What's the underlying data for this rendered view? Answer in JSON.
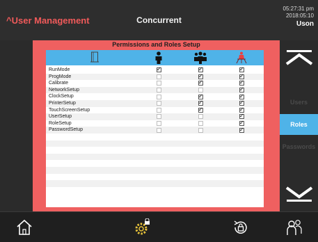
{
  "header": {
    "app_title": "^User Management",
    "mode": "Concurrent",
    "time": "05:27:31 pm",
    "date": "2018:05:10",
    "user": "Uson"
  },
  "panel": {
    "title": "Permissions and Roles Setup",
    "columns": [
      {
        "icon": "door-icon"
      },
      {
        "icon": "operator-icon"
      },
      {
        "icon": "group-icon"
      },
      {
        "icon": "admin-icon"
      }
    ],
    "rows": [
      {
        "label": "RunMode",
        "c1": true,
        "c2": true,
        "c3": true
      },
      {
        "label": "ProgMode",
        "c1": false,
        "c2": true,
        "c3": true
      },
      {
        "label": "Calibrate",
        "c1": false,
        "c2": true,
        "c3": true
      },
      {
        "label": "NetworkSetup",
        "c1": false,
        "c2": false,
        "c3": true
      },
      {
        "label": "ClockSetup",
        "c1": false,
        "c2": true,
        "c3": true
      },
      {
        "label": "PrinterSetup",
        "c1": false,
        "c2": true,
        "c3": true
      },
      {
        "label": "TouchScreenSetup",
        "c1": false,
        "c2": true,
        "c3": true
      },
      {
        "label": "UserSetup",
        "c1": false,
        "c2": false,
        "c3": true
      },
      {
        "label": "RoleSetup",
        "c1": false,
        "c2": false,
        "c3": true
      },
      {
        "label": "PasswordSetup",
        "c1": false,
        "c2": false,
        "c3": true
      }
    ],
    "empty_rows": 8
  },
  "side_tabs": [
    {
      "label": "Users",
      "active": false
    },
    {
      "label": "Roles",
      "active": true
    },
    {
      "label": "Passwords",
      "active": false
    }
  ],
  "nav": {
    "scroll_up_icon": "chevron-up-icon",
    "scroll_down_icon": "chevron-down-icon",
    "home_icon": "home-icon",
    "settings_icon": "settings-lock-icon",
    "logout_icon": "rotate-lock-icon",
    "users_icon": "users-icon"
  },
  "colors": {
    "accent_blue": "#4fb3e8",
    "panel_red": "#ef6060",
    "title_red": "#f05a5a",
    "dark": "#2b2b2b",
    "icon_yellow": "#e8c33a"
  }
}
